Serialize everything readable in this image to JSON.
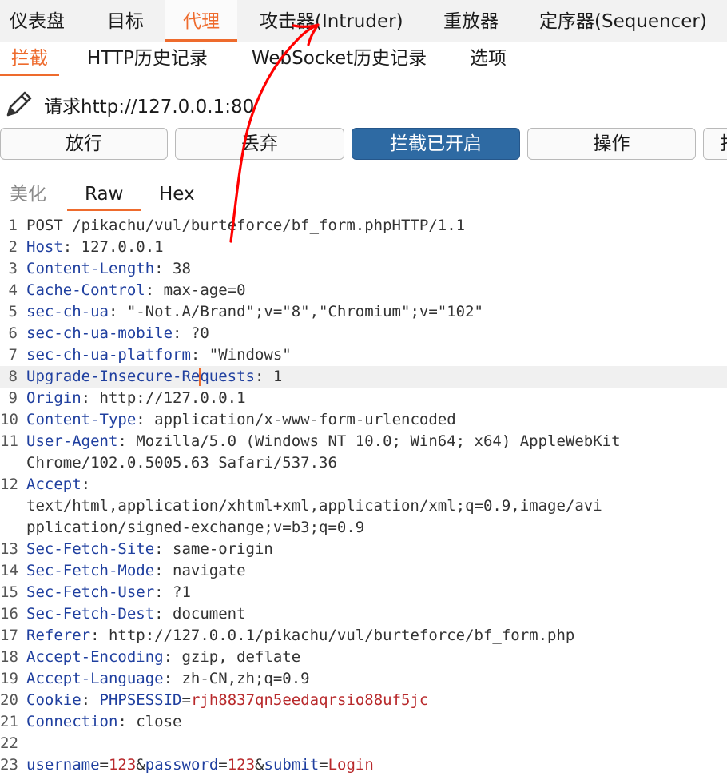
{
  "top_tabs": [
    "仪表盘",
    "目标",
    "代理",
    "攻击器(Intruder)",
    "重放器",
    "定序器(Sequencer)"
  ],
  "sub_tabs": [
    "拦截",
    "HTTP历史记录",
    "WebSocket历史记录",
    "选项"
  ],
  "request": {
    "label": "请求http://127.0.0.1:80"
  },
  "buttons": {
    "forward": "放行",
    "drop": "丢弃",
    "intercept": "拦截已开启",
    "action": "操作",
    "extra": "打"
  },
  "view_tabs": [
    "美化",
    "Raw",
    "Hex"
  ],
  "editor": {
    "lines": [
      {
        "n": "1",
        "name": "POST /pikachu/vul/burteforce/bf_form.phpHTTP/1.1"
      },
      {
        "n": "2",
        "name": "Host",
        "value": ": 127.0.0.1"
      },
      {
        "n": "3",
        "name": "Content-Length",
        "value": ": 38"
      },
      {
        "n": "4",
        "name": "Cache-Control",
        "value": ": max-age=0"
      },
      {
        "n": "5",
        "name": "sec-ch-ua",
        "value": ": \"-Not.A/Brand\";v=\"8\",\"Chromium\";v=\"102\""
      },
      {
        "n": "6",
        "name": "sec-ch-ua-mobile",
        "value": ": ?0"
      },
      {
        "n": "7",
        "name": "sec-ch-ua-platform",
        "value": ": \"Windows\""
      },
      {
        "n": "8",
        "name_a": "Upgrade-Insecure-Re",
        "name_b": "quests",
        "value": ": 1"
      },
      {
        "n": "9",
        "name": "Origin",
        "value": ": http://127.0.0.1"
      },
      {
        "n": "10",
        "name": "Content-Type",
        "value": ": application/x-www-form-urlencoded"
      },
      {
        "n": "11",
        "name": "User-Agent",
        "value": ": Mozilla/5.0 (Windows NT 10.0; Win64; x64) AppleWebKit"
      },
      {
        "n": "",
        "value": "Chrome/102.0.5005.63 Safari/537.36"
      },
      {
        "n": "12",
        "name": "Accept",
        "value": ":"
      },
      {
        "n": "",
        "value": "text/html,application/xhtml+xml,application/xml;q=0.9,image/avi"
      },
      {
        "n": "",
        "value": "pplication/signed-exchange;v=b3;q=0.9"
      },
      {
        "n": "13",
        "name": "Sec-Fetch-Site",
        "value": ": same-origin"
      },
      {
        "n": "14",
        "name": "Sec-Fetch-Mode",
        "value": ": navigate"
      },
      {
        "n": "15",
        "name": "Sec-Fetch-User",
        "value": ": ?1"
      },
      {
        "n": "16",
        "name": "Sec-Fetch-Dest",
        "value": ": document"
      },
      {
        "n": "17",
        "name": "Referer",
        "value": ": http://127.0.0.1/pikachu/vul/burteforce/bf_form.php"
      },
      {
        "n": "18",
        "name": "Accept-Encoding",
        "value": ": gzip, deflate"
      },
      {
        "n": "19",
        "name": "Accept-Language",
        "value": ": zh-CN,zh;q=0.9"
      },
      {
        "n": "20",
        "name": "Cookie",
        "value": ": ",
        "name2": "PHPSESSID",
        "eq": "=",
        "cval": "rjh8837qn5eedaqrsio88uf5jc"
      },
      {
        "n": "21",
        "name": "Connection",
        "value": ": close"
      },
      {
        "n": "22"
      },
      {
        "n": "23",
        "name": "username",
        "eq": "=",
        "cval": "123",
        "amp1": "&",
        "name2": "password",
        "eq2": "=",
        "cval2": "123",
        "amp2": "&",
        "name3": "submit",
        "eq3": "=",
        "cval3": "Login"
      }
    ]
  },
  "colors": {
    "accent": "#ee6b2d",
    "primary_button": "#2e6aa3",
    "header_name": "#1f3f9f",
    "cookie_value": "#b8292b",
    "arrow": "#ff0000"
  }
}
